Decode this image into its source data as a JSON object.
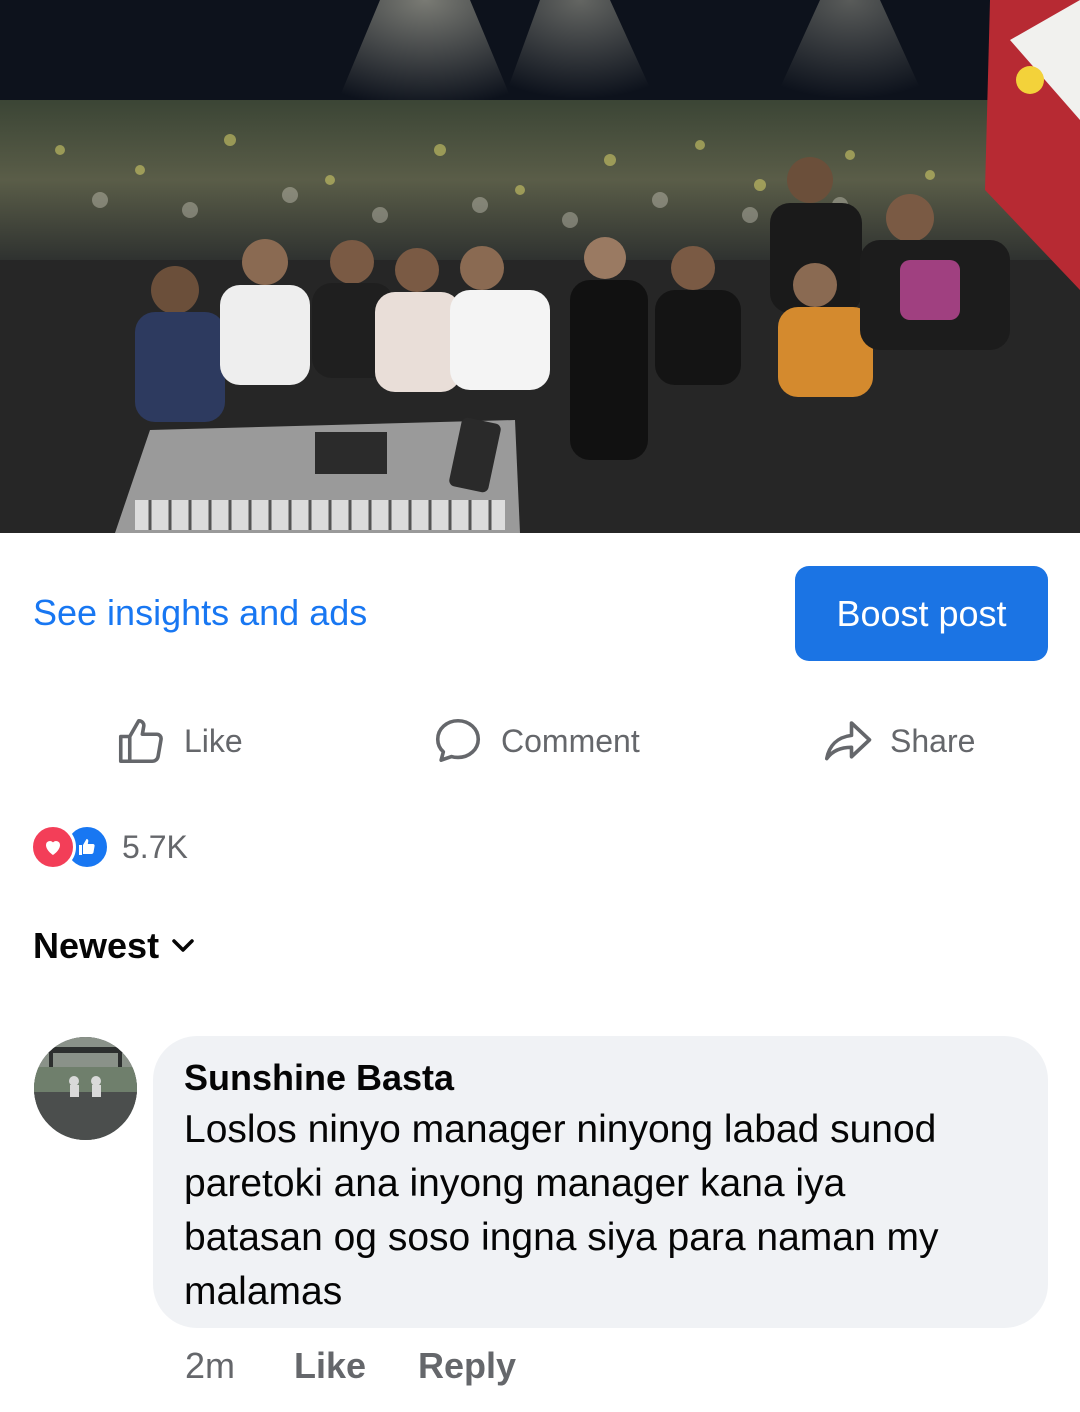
{
  "post": {
    "photo_alt": "photo",
    "insights_link": "See insights and ads",
    "boost_button": "Boost post"
  },
  "actions": {
    "like": "Like",
    "comment": "Comment",
    "share": "Share"
  },
  "reactions": {
    "types": [
      "love",
      "like"
    ],
    "count": "5.7K"
  },
  "comments_sort": {
    "label": "Newest"
  },
  "comment": {
    "author": "Sunshine Basta",
    "text": "Loslos ninyo  manager ninyong labad sunod\nparetoki ana inyong manager kana iya\nbatasan og soso ingna siya para naman my\nmalamas",
    "time": "2m",
    "like": "Like",
    "reply": "Reply"
  },
  "colors": {
    "accent": "#1877f2",
    "boost_bg": "#1b74e4",
    "muted_text": "#65676b",
    "bubble_bg": "#f0f2f5",
    "love": "#f33e58"
  }
}
